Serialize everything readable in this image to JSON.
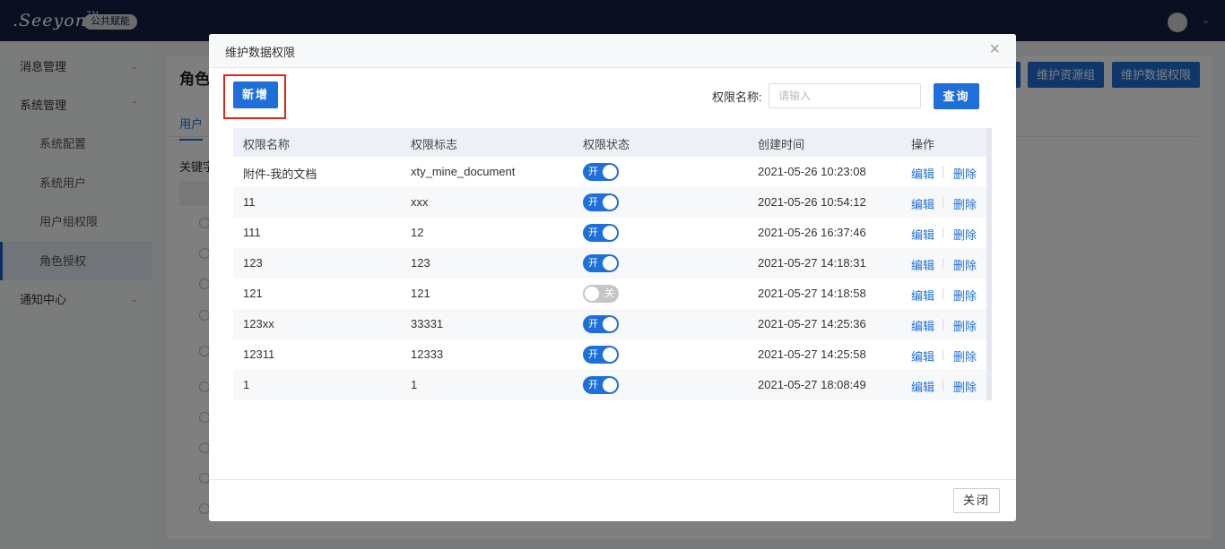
{
  "topbar": {
    "logo_text": ".Seeyon",
    "logo_tm": "TM",
    "badge": "公共赋能",
    "user_chevron": "⌄"
  },
  "sidebar": {
    "items": [
      {
        "label": "消息管理",
        "chevron": "⌄"
      },
      {
        "label": "系统管理",
        "chevron": "⌃"
      },
      {
        "label": "系统配置"
      },
      {
        "label": "系统用户"
      },
      {
        "label": "用户组权限"
      },
      {
        "label": "角色授权"
      },
      {
        "label": "通知中心",
        "chevron": "⌄"
      }
    ]
  },
  "main": {
    "title": "角色",
    "tab": "用户",
    "keyword_label": "关键字",
    "top_buttons": [
      "维护资源组",
      "维护数据权限"
    ]
  },
  "dialog": {
    "title": "维护数据权限",
    "close_icon": "×",
    "add_button": "新增",
    "search_label": "权限名称:",
    "search_placeholder": "请输入",
    "search_value": "",
    "query_button": "查询",
    "close_button": "关闭",
    "columns": [
      "权限名称",
      "权限标志",
      "权限状态",
      "创建时间",
      "操作"
    ],
    "rows": [
      {
        "name": "附件-我的文档",
        "flag": "xty_mine_document",
        "status": "开",
        "on": true,
        "created": "2021-05-26 10:23:08"
      },
      {
        "name": "11",
        "flag": "xxx",
        "status": "开",
        "on": true,
        "created": "2021-05-26 10:54:12"
      },
      {
        "name": "111",
        "flag": "12",
        "status": "开",
        "on": true,
        "created": "2021-05-26 16:37:46"
      },
      {
        "name": "123",
        "flag": "123",
        "status": "开",
        "on": true,
        "created": "2021-05-27 14:18:31"
      },
      {
        "name": "121",
        "flag": "121",
        "status": "关",
        "on": false,
        "created": "2021-05-27 14:18:58"
      },
      {
        "name": "123xx",
        "flag": "33331",
        "status": "开",
        "on": true,
        "created": "2021-05-27 14:25:36"
      },
      {
        "name": "12311",
        "flag": "12333",
        "status": "开",
        "on": true,
        "created": "2021-05-27 14:25:58"
      },
      {
        "name": "1",
        "flag": "1",
        "status": "开",
        "on": true,
        "created": "2021-05-27 18:08:49"
      }
    ],
    "actions": {
      "edit": "编辑",
      "delete": "删除"
    }
  },
  "colors": {
    "topbar": "#142144",
    "primary": "#1e6fd9",
    "highlight": "#e1251b",
    "switch_off": "#c6c6c6"
  }
}
